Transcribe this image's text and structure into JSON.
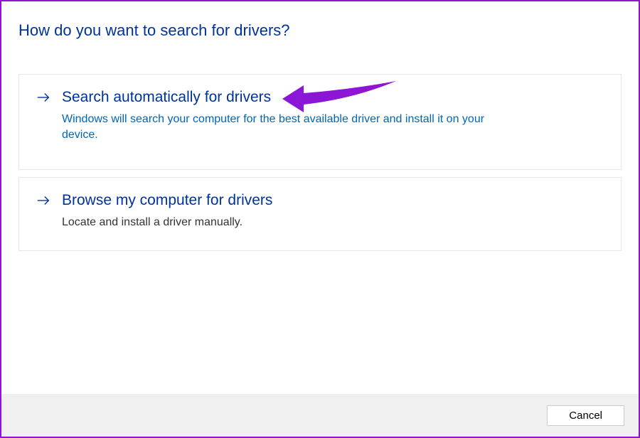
{
  "title": "How do you want to search for drivers?",
  "options": [
    {
      "title": "Search automatically for drivers",
      "desc": "Windows will search your computer for the best available driver and install it on your device."
    },
    {
      "title": "Browse my computer for drivers",
      "desc": "Locate and install a driver manually."
    }
  ],
  "footer": {
    "cancel": "Cancel"
  }
}
